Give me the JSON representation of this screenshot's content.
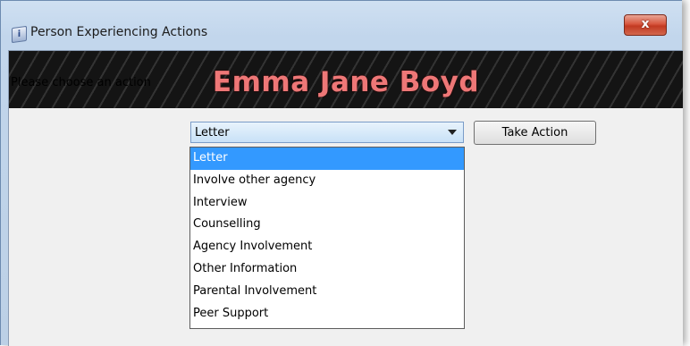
{
  "window": {
    "title": "Person Experiencing Actions",
    "icon": "app-icon",
    "close_label": "x"
  },
  "banner": {
    "name": "Emma Jane Boyd",
    "name_color": "#ee7777"
  },
  "action": {
    "prompt": "Please choose an action",
    "selected": "Letter",
    "button_label": "Take Action",
    "options": [
      "Letter",
      "Involve other agency",
      "Interview",
      "Counselling",
      "Agency Involvement",
      "Other Information",
      "Parental Involvement",
      "Peer Support"
    ],
    "highlight_color": "#3399ff"
  }
}
